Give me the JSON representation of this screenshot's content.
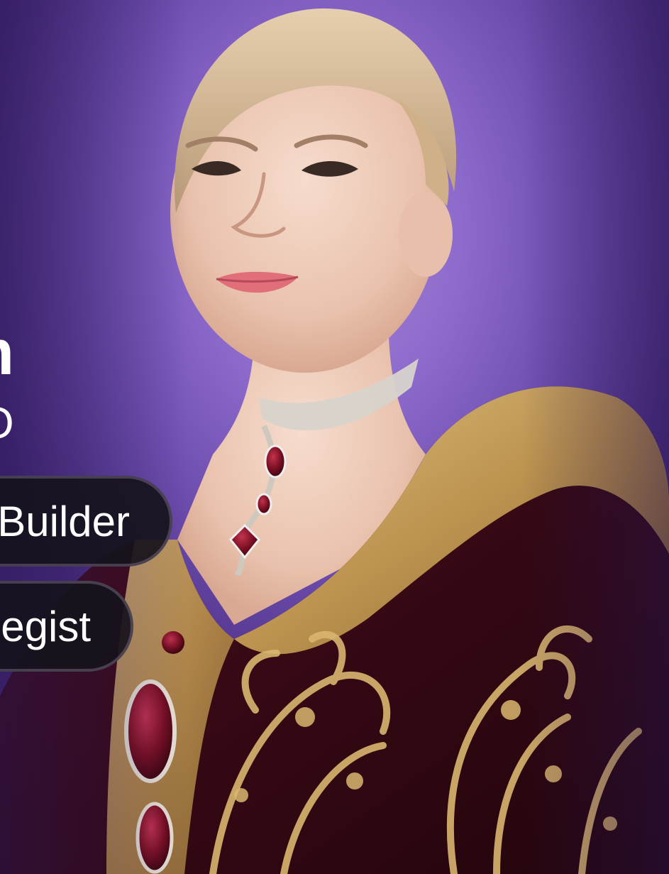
{
  "profile": {
    "name": "m",
    "role": "EO"
  },
  "tags": [
    {
      "label": "Builder"
    },
    {
      "label": "egist"
    }
  ],
  "colors": {
    "background": "#8d6bcc",
    "pill_background": "#16121c",
    "text": "#ffffff",
    "dress_velvet": "#3b0a17",
    "embroidery_gold": "#c9a35a",
    "jewel_ruby": "#7a0f22"
  }
}
